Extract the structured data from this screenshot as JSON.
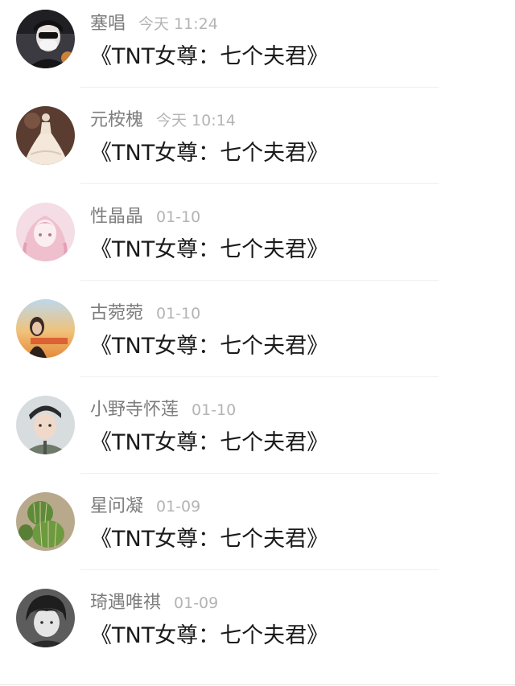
{
  "comments": [
    {
      "name": "塞唱",
      "time": "今天 11:24",
      "text": "《TNT女尊：七个夫君》",
      "avatar_icon": "avatar-masked-person",
      "avatar_bg": "#2d2d33"
    },
    {
      "name": "元桉槐",
      "time": "今天 10:14",
      "text": "《TNT女尊：七个夫君》",
      "avatar_icon": "avatar-bride-dress",
      "avatar_bg": "#6b4a3a"
    },
    {
      "name": "性晶晶",
      "time": "01-10",
      "text": "《TNT女尊：七个夫君》",
      "avatar_icon": "avatar-anime-girl-pink",
      "avatar_bg": "#f2d3dc"
    },
    {
      "name": "古菀菀",
      "time": "01-10",
      "text": "《TNT女尊：七个夫君》",
      "avatar_icon": "avatar-girl-sunset",
      "avatar_bg": "#e9b66a"
    },
    {
      "name": "小野寺怀莲",
      "time": "01-10",
      "text": "《TNT女尊：七个夫君》",
      "avatar_icon": "avatar-boy-portrait",
      "avatar_bg": "#cfd4d6"
    },
    {
      "name": "星问凝",
      "time": "01-09",
      "text": "《TNT女尊：七个夫君》",
      "avatar_icon": "avatar-cactus",
      "avatar_bg": "#b3a58a"
    },
    {
      "name": "琦遇唯祺",
      "time": "01-09",
      "text": "《TNT女尊：七个夫君》",
      "avatar_icon": "avatar-boy-bw",
      "avatar_bg": "#6a6a6a"
    }
  ]
}
